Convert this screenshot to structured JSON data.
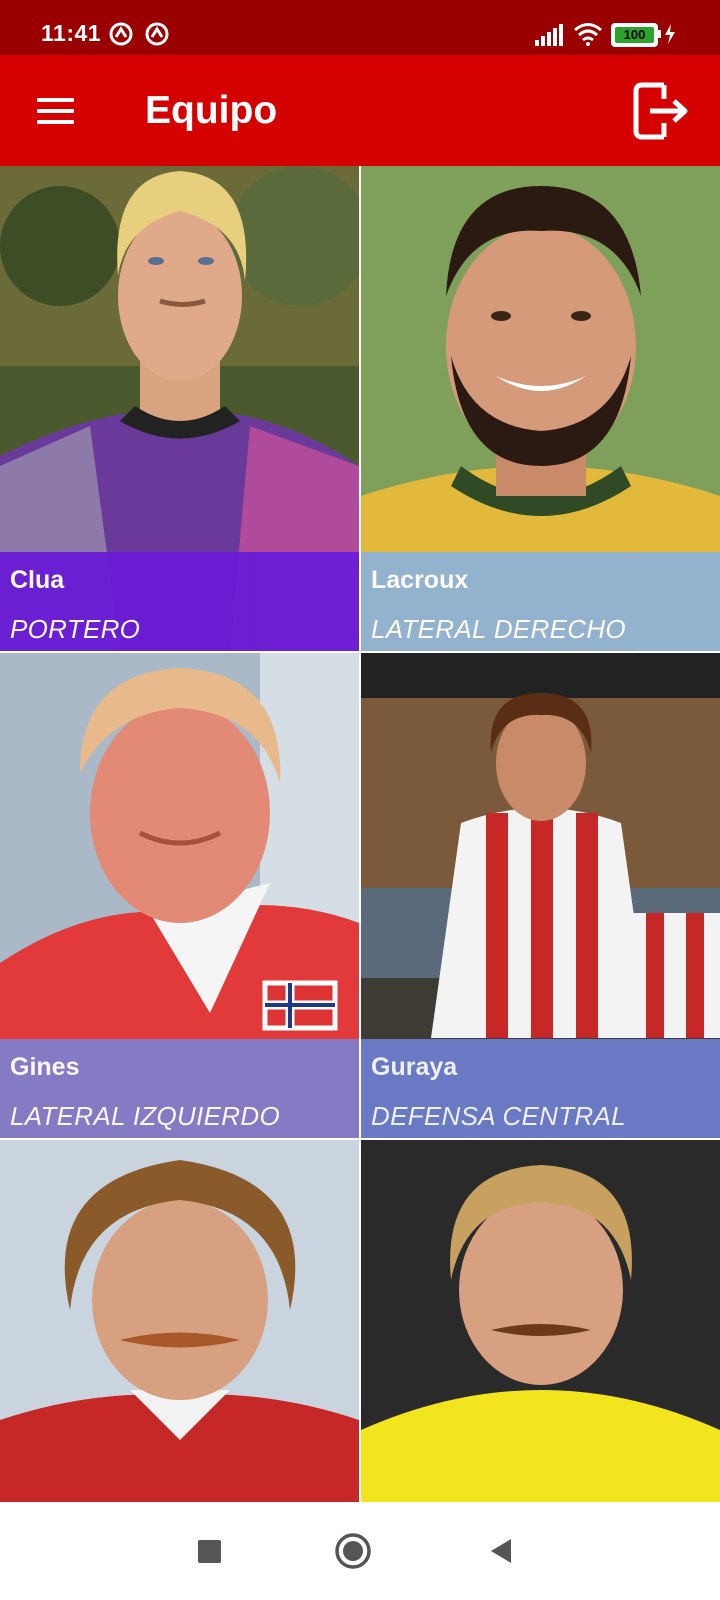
{
  "status_bar": {
    "time": "11:41",
    "battery": "100",
    "icons": [
      "notification-icon",
      "notification-icon",
      "signal-icon",
      "wifi-icon",
      "battery-icon",
      "charging-icon"
    ]
  },
  "app_bar": {
    "title": "Equipo",
    "menu_icon": "hamburger-menu-icon",
    "logout_icon": "exit-icon"
  },
  "players": [
    {
      "name": "Clua",
      "position": "PORTERO",
      "caption_color": "#6a1bd6"
    },
    {
      "name": "Lacroux",
      "position": "LATERAL DERECHO",
      "caption_color": "#8fb2d6"
    },
    {
      "name": "Gines",
      "position": "LATERAL IZQUIERDO",
      "caption_color": "#7f7fcc"
    },
    {
      "name": "Guraya",
      "position": "DEFENSA CENTRAL",
      "caption_color": "#6d7fd0"
    },
    {
      "name": "",
      "position": ""
    },
    {
      "name": "",
      "position": ""
    }
  ],
  "nav_bar": {
    "icons": [
      "recents-square-icon",
      "home-circle-icon",
      "back-triangle-icon"
    ]
  }
}
